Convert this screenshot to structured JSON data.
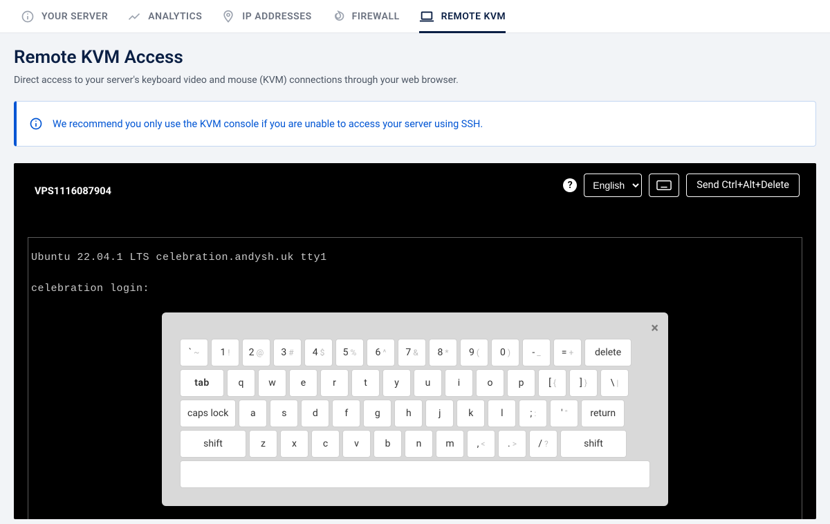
{
  "tabs": [
    {
      "label": "YOUR SERVER",
      "icon": "info"
    },
    {
      "label": "ANALYTICS",
      "icon": "trend"
    },
    {
      "label": "IP ADDRESSES",
      "icon": "location"
    },
    {
      "label": "FIREWALL",
      "icon": "flame"
    },
    {
      "label": "REMOTE KVM",
      "icon": "laptop",
      "active": true
    }
  ],
  "page": {
    "title": "Remote KVM Access",
    "description": "Direct access to your server's keyboard video and mouse (KVM) connections through your web browser."
  },
  "banner": {
    "text": "We recommend you only use the KVM console if you are unable to access your server using SSH."
  },
  "kvm": {
    "server_id": "VPS1116087904",
    "language": "English",
    "send_cad_label": "Send Ctrl+Alt+Delete",
    "terminal_line1": "Ubuntu 22.04.1 LTS celebration.andysh.uk tty1",
    "terminal_line2": "celebration login:"
  },
  "keyboard": {
    "close": "×",
    "row1": [
      {
        "main": "`",
        "sub": "~"
      },
      {
        "main": "1",
        "sub": "!"
      },
      {
        "main": "2",
        "sub": "@"
      },
      {
        "main": "3",
        "sub": "#"
      },
      {
        "main": "4",
        "sub": "$"
      },
      {
        "main": "5",
        "sub": "%"
      },
      {
        "main": "6",
        "sub": "^"
      },
      {
        "main": "7",
        "sub": "&"
      },
      {
        "main": "8",
        "sub": "*"
      },
      {
        "main": "9",
        "sub": "("
      },
      {
        "main": "0",
        "sub": ")"
      },
      {
        "main": "-",
        "sub": "_"
      },
      {
        "main": "=",
        "sub": "+"
      },
      {
        "main": "delete",
        "wide": "delete"
      }
    ],
    "row2": [
      {
        "main": "tab",
        "wide": "tab"
      },
      {
        "main": "q"
      },
      {
        "main": "w"
      },
      {
        "main": "e"
      },
      {
        "main": "r"
      },
      {
        "main": "t"
      },
      {
        "main": "y"
      },
      {
        "main": "u"
      },
      {
        "main": "i"
      },
      {
        "main": "o"
      },
      {
        "main": "p"
      },
      {
        "main": "[",
        "sub": "{"
      },
      {
        "main": "]",
        "sub": "}"
      },
      {
        "main": "\\",
        "sub": "|"
      }
    ],
    "row3": [
      {
        "main": "caps lock",
        "wide": "caps"
      },
      {
        "main": "a"
      },
      {
        "main": "s"
      },
      {
        "main": "d"
      },
      {
        "main": "f"
      },
      {
        "main": "g"
      },
      {
        "main": "h"
      },
      {
        "main": "j"
      },
      {
        "main": "k"
      },
      {
        "main": "l"
      },
      {
        "main": ";",
        "sub": ":"
      },
      {
        "main": "'",
        "sub": "\""
      },
      {
        "main": "return",
        "wide": "return"
      }
    ],
    "row4": [
      {
        "main": "shift",
        "wide": "shift-l"
      },
      {
        "main": "z"
      },
      {
        "main": "x"
      },
      {
        "main": "c"
      },
      {
        "main": "v"
      },
      {
        "main": "b"
      },
      {
        "main": "n"
      },
      {
        "main": "m"
      },
      {
        "main": ",",
        "sub": "<"
      },
      {
        "main": ".",
        "sub": ">"
      },
      {
        "main": "/",
        "sub": "?"
      },
      {
        "main": "shift",
        "wide": "shift-r"
      }
    ]
  }
}
